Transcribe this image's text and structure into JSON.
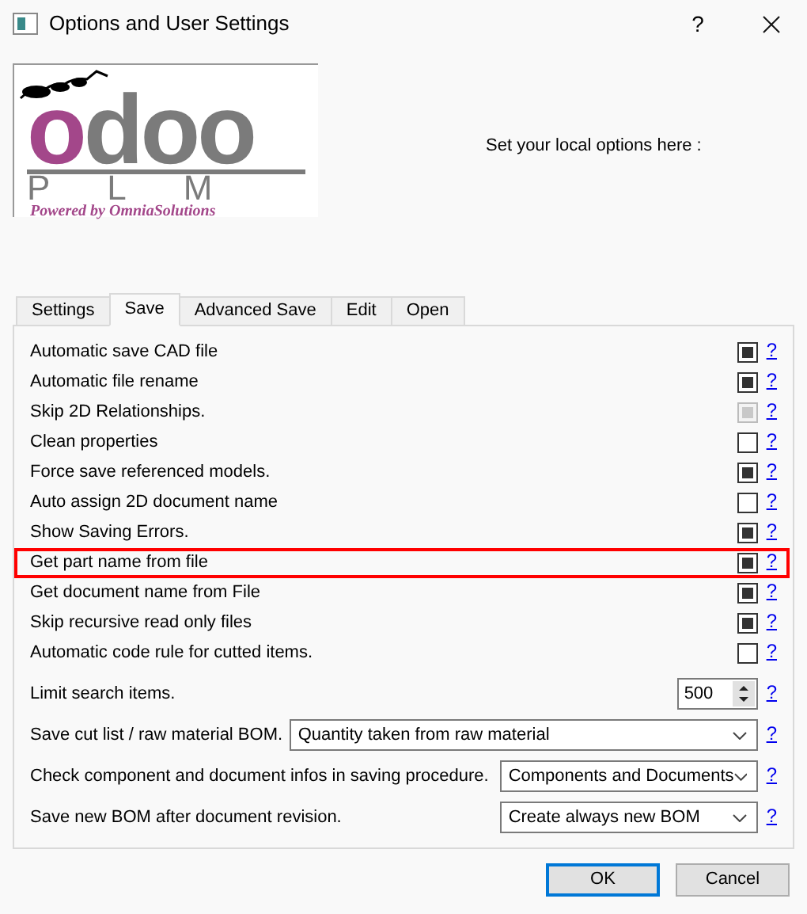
{
  "window": {
    "title": "Options and User Settings",
    "help": "?"
  },
  "logo": {
    "word": "odoo",
    "product": "PLM",
    "tagline": "Powered by OmniaSolutions"
  },
  "intro": "Set your local options here :",
  "tabs": [
    {
      "label": "Settings",
      "selected": false
    },
    {
      "label": "Save",
      "selected": true
    },
    {
      "label": "Advanced Save",
      "selected": false
    },
    {
      "label": "Edit",
      "selected": false
    },
    {
      "label": "Open",
      "selected": false
    }
  ],
  "options": [
    {
      "kind": "checkbox",
      "label": "Automatic save CAD file",
      "checked": true,
      "disabled": false,
      "help": "?"
    },
    {
      "kind": "checkbox",
      "label": "Automatic file rename",
      "checked": true,
      "disabled": false,
      "help": "?"
    },
    {
      "kind": "checkbox",
      "label": "Skip 2D Relationships.",
      "checked": true,
      "disabled": true,
      "help": "?"
    },
    {
      "kind": "checkbox",
      "label": "Clean properties",
      "checked": false,
      "disabled": false,
      "help": "?"
    },
    {
      "kind": "checkbox",
      "label": "Force save referenced models.",
      "checked": true,
      "disabled": false,
      "help": "?"
    },
    {
      "kind": "checkbox",
      "label": "Auto assign 2D document name",
      "checked": false,
      "disabled": false,
      "help": "?"
    },
    {
      "kind": "checkbox",
      "label": "Show Saving Errors.",
      "checked": true,
      "disabled": false,
      "help": "?"
    },
    {
      "kind": "checkbox",
      "label": "Get part name from file",
      "checked": true,
      "disabled": false,
      "highlighted": true,
      "help": "?"
    },
    {
      "kind": "checkbox",
      "label": "Get document name from File",
      "checked": true,
      "disabled": false,
      "help": "?"
    },
    {
      "kind": "checkbox",
      "label": "Skip recursive read only files",
      "checked": true,
      "disabled": false,
      "help": "?"
    },
    {
      "kind": "checkbox",
      "label": "Automatic code rule for cutted items.",
      "checked": false,
      "disabled": false,
      "help": "?"
    },
    {
      "kind": "spin",
      "label": "Limit search items.",
      "value": "500",
      "help": "?"
    },
    {
      "kind": "dropdown",
      "label": "Save cut list / raw material BOM.",
      "value": "Quantity taken from raw material",
      "help": "?"
    },
    {
      "kind": "dropdown",
      "label": "Check component and document infos in saving procedure.",
      "value": "Components and Documents",
      "help": "?"
    },
    {
      "kind": "dropdown",
      "label": "Save new BOM after document revision.",
      "value": "Create always new BOM",
      "help": "?"
    }
  ],
  "buttons": [
    {
      "label": "OK",
      "default": true
    },
    {
      "label": "Cancel",
      "default": false
    }
  ]
}
